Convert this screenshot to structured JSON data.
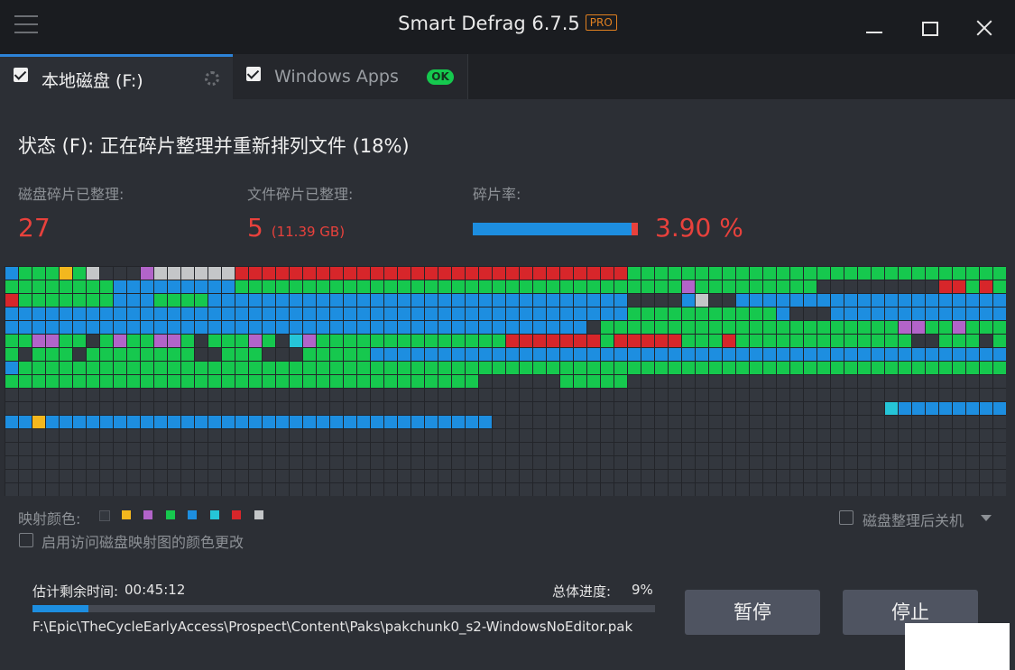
{
  "window": {
    "title": "Smart Defrag 6.7.5",
    "edition_badge": "PRO"
  },
  "tabs": [
    {
      "label": "本地磁盘 (F:)",
      "checked": true,
      "active": true
    },
    {
      "label": "Windows Apps",
      "checked": true,
      "active": false,
      "badge": "OK"
    }
  ],
  "status": {
    "text": "状态 (F): 正在碎片整理并重新排列文件 (18%)"
  },
  "stats": {
    "disk_defragged_label": "磁盘碎片已整理:",
    "disk_defragged_value": "27",
    "files_defragged_label": "文件碎片已整理:",
    "files_defragged_value": "5",
    "files_defragged_size": "(11.39 GB)",
    "frag_rate_label": "碎片率:",
    "frag_rate_value": "3.90 %",
    "frag_rate_fraction": 0.039
  },
  "disk_map": {
    "palette": {
      "free": "#33373e",
      "yellow": "#f3b71e",
      "purple": "#b264c9",
      "green": "#16c84e",
      "blue": "#1d8ee0",
      "cyan": "#25c5d8",
      "red": "#d7262a",
      "gray": "#c4c6c8"
    }
  },
  "legend": {
    "label": "映射颜色:",
    "colors": [
      "#33373e",
      "#f3b71e",
      "#b264c9",
      "#16c84e",
      "#1d8ee0",
      "#25c5d8",
      "#d7262a",
      "#c4c6c8"
    ]
  },
  "options": {
    "color_change_label": "启用访问磁盘映射图的颜色更改",
    "color_change_checked": false,
    "shutdown_label": "磁盘整理后关机",
    "shutdown_checked": false
  },
  "progress": {
    "eta_label": "估计剩余时间:",
    "eta_value": "00:45:12",
    "overall_label": "总体进度:",
    "overall_value": "9%",
    "overall_fraction": 0.09,
    "current_file": "F:\\Epic\\TheCycleEarlyAccess\\Prospect\\Content\\Paks\\pakchunk0_s2-WindowsNoEditor.pak"
  },
  "buttons": {
    "pause_label": "暂停",
    "stop_label": "停止"
  }
}
